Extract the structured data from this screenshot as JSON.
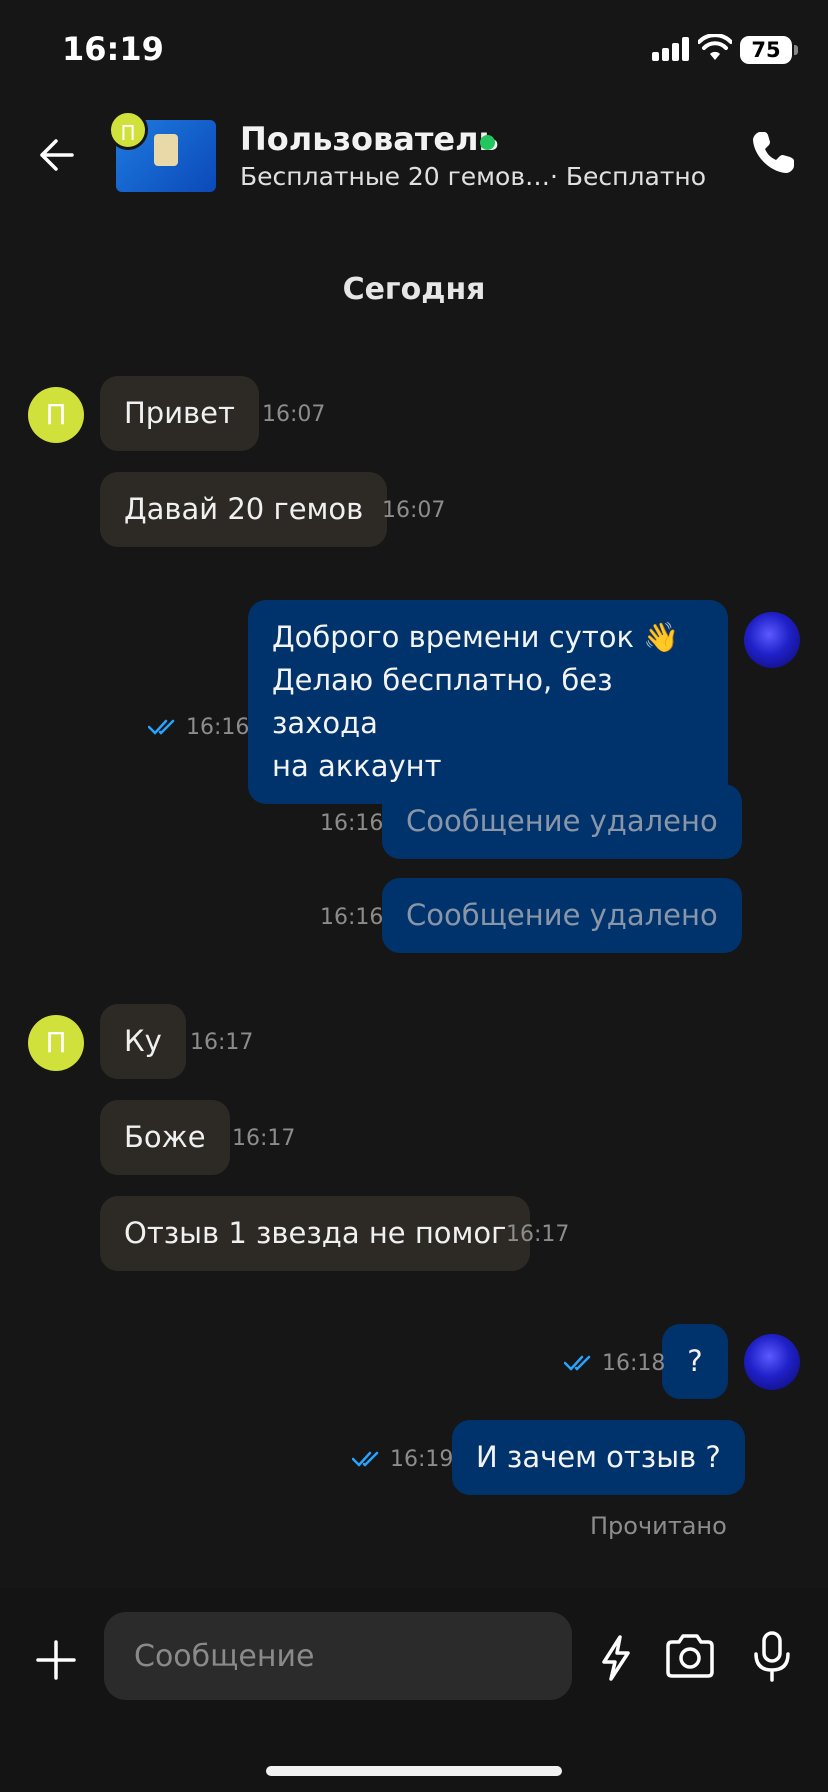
{
  "status_bar": {
    "time": "16:19",
    "battery": "75"
  },
  "header": {
    "avatar_letter": "П",
    "title": "Пользователь",
    "listing_title": "Бесплатные 20 гемов…",
    "price": "· Бесплатно"
  },
  "day_label": "Сегодня",
  "messages": [
    {
      "dir": "in",
      "text": "Привет",
      "time": "16:07",
      "avatar": "П"
    },
    {
      "dir": "in",
      "text": "Давай 20 гемов",
      "time": "16:07"
    },
    {
      "dir": "out",
      "lines": [
        "Доброго времени суток 👋",
        "Делаю бесплатно, без захода",
        "на аккаунт"
      ],
      "time": "16:16",
      "read": true
    },
    {
      "dir": "out",
      "text": "Сообщение удалено",
      "time": "16:16",
      "deleted": true
    },
    {
      "dir": "out",
      "text": "Сообщение удалено",
      "time": "16:16",
      "deleted": true
    },
    {
      "dir": "in",
      "text": "Ку",
      "time": "16:17",
      "avatar": "П"
    },
    {
      "dir": "in",
      "text": "Боже",
      "time": "16:17"
    },
    {
      "dir": "in",
      "text": "Отзыв 1 звезда не помог",
      "time": "16:17"
    },
    {
      "dir": "out",
      "text": "?",
      "time": "16:18",
      "read": true
    },
    {
      "dir": "out",
      "text": "И зачем отзыв ?",
      "time": "16:19",
      "read": true
    }
  ],
  "read_receipt": "Прочитано",
  "composer": {
    "placeholder": "Сообщение"
  },
  "colors": {
    "incoming_bubble": "#2d2a26",
    "outgoing_bubble": "#00336b",
    "online": "#22c55e",
    "avatar": "#cfe13a",
    "read_ticks": "#2aa3ff"
  },
  "icons": [
    "back-arrow-icon",
    "phone-icon",
    "plus-icon",
    "lightning-icon",
    "camera-icon",
    "microphone-icon",
    "double-check-icon"
  ]
}
